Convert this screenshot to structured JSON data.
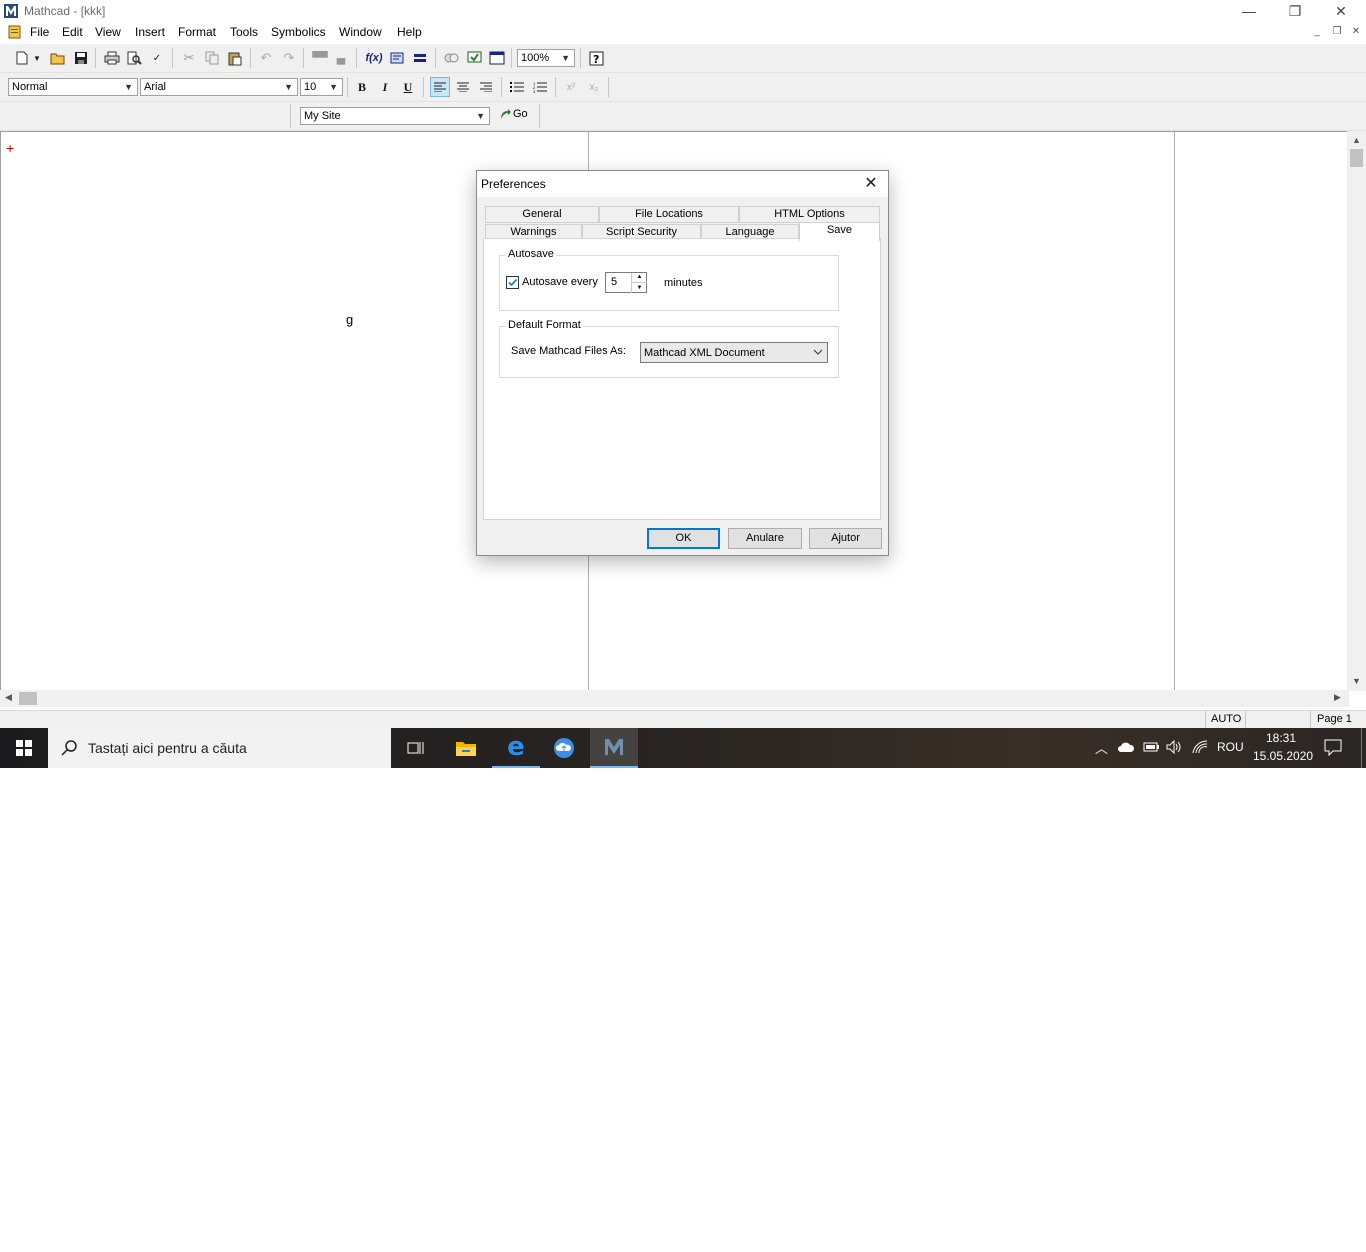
{
  "window": {
    "title": "Mathcad - [kkk]",
    "controls": {
      "minimize": "—",
      "restore": "❐",
      "close": "✕"
    }
  },
  "menubar": {
    "items": [
      "File",
      "Edit",
      "View",
      "Insert",
      "Format",
      "Tools",
      "Symbolics",
      "Window",
      "Help"
    ],
    "mdi_controls": {
      "minimize": "_",
      "restore": "❐",
      "close": "✕"
    }
  },
  "standard_toolbar": {
    "zoom": "100%"
  },
  "formatting_toolbar": {
    "style": "Normal",
    "font": "Arial",
    "size": "10",
    "bold": "B",
    "italic": "I",
    "underline": "U"
  },
  "web_toolbar": {
    "address": "My Site",
    "go_label": "Go"
  },
  "document": {
    "cursor": "+",
    "text_g": "g"
  },
  "statusbar": {
    "mode": "AUTO",
    "page": "Page 1"
  },
  "taskbar": {
    "search_placeholder": "Tastați aici pentru a căuta",
    "language": "ROU",
    "time": "18:31",
    "date": "15.05.2020"
  },
  "dialog": {
    "title": "Preferences",
    "tabs_row1": [
      "General",
      "File Locations",
      "HTML Options"
    ],
    "tabs_row2": [
      "Warnings",
      "Script Security",
      "Language",
      "Save"
    ],
    "active_tab": "Save",
    "autosave": {
      "group_title": "Autosave",
      "checkbox_label": "Autosave every",
      "checked": true,
      "value": "5",
      "unit": "minutes"
    },
    "default_format": {
      "group_title": "Default Format",
      "label": "Save Mathcad Files As:",
      "selected": "Mathcad XML Document"
    },
    "buttons": {
      "ok": "OK",
      "cancel": "Anulare",
      "help": "Ajutor"
    }
  },
  "colors": {
    "accent": "#0078d7",
    "cursor_red": "#d40000"
  }
}
